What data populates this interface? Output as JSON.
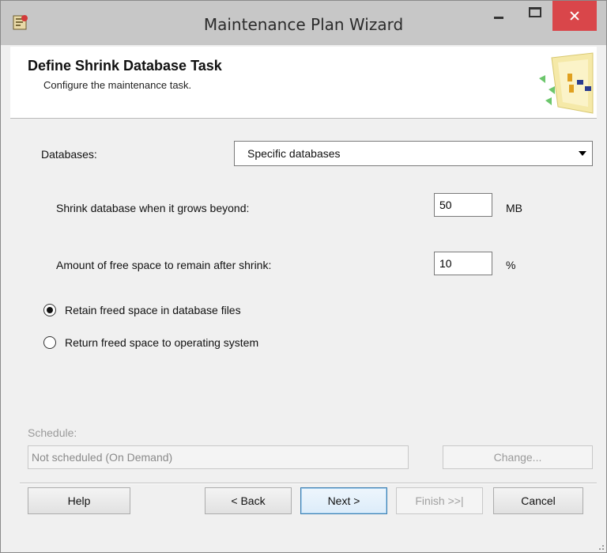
{
  "window": {
    "title": "Maintenance Plan Wizard"
  },
  "header": {
    "heading": "Define Shrink Database Task",
    "subheading": "Configure the maintenance task."
  },
  "form": {
    "databases_label": "Databases:",
    "databases_value": "Specific databases",
    "shrink_label": "Shrink database when it grows beyond:",
    "shrink_value": "50",
    "shrink_unit": "MB",
    "free_space_label": "Amount of free space to remain after shrink:",
    "free_space_value": "10",
    "free_space_unit": "%",
    "radio_retain_label": "Retain freed space in database files",
    "radio_return_label": "Return freed space to operating system",
    "selected_option": "retain"
  },
  "schedule": {
    "label": "Schedule:",
    "value": "Not scheduled (On Demand)",
    "change_label": "Change..."
  },
  "footer": {
    "help_label": "Help",
    "back_label": "< Back",
    "next_label": "Next >",
    "finish_label": "Finish >>|",
    "cancel_label": "Cancel"
  },
  "colors": {
    "close_button": "#d9464a",
    "titlebar": "#c7c7c7",
    "next_button_border": "#3c7fb1"
  }
}
